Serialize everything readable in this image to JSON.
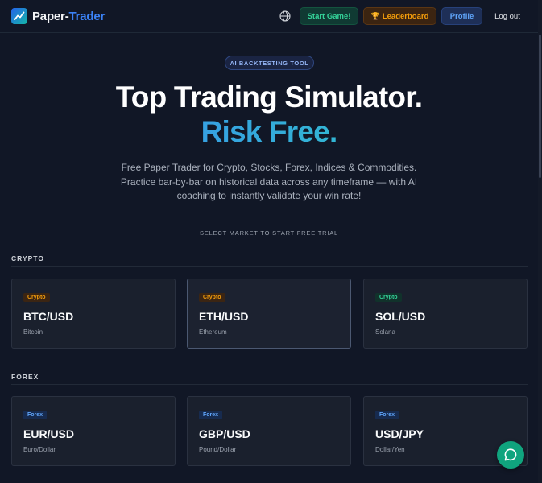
{
  "brand": {
    "part1": "Paper-",
    "part2": "Trader"
  },
  "nav": {
    "start": "Start Game!",
    "leaderboard_icon": "🏆",
    "leaderboard": "Leaderboard",
    "profile": "Profile",
    "logout": "Log out"
  },
  "hero": {
    "badge": "AI BACKTESTING TOOL",
    "title_line1": "Top Trading Simulator.",
    "title_line2": "Risk Free.",
    "subtitle": "Free Paper Trader for Crypto, Stocks, Forex, Indices & Commodities. Practice bar-by-bar on historical data across any timeframe — with AI coaching to instantly validate your win rate!",
    "select_label": "SELECT MARKET TO START FREE TRIAL"
  },
  "sections": {
    "crypto": {
      "title": "CRYPTO",
      "cards": [
        {
          "tag": "Crypto",
          "pair": "BTC/USD",
          "name": "Bitcoin"
        },
        {
          "tag": "Crypto",
          "pair": "ETH/USD",
          "name": "Ethereum"
        },
        {
          "tag": "Crypto",
          "pair": "SOL/USD",
          "name": "Solana"
        }
      ]
    },
    "forex": {
      "title": "FOREX",
      "cards": [
        {
          "tag": "Forex",
          "pair": "EUR/USD",
          "name": "Euro/Dollar"
        },
        {
          "tag": "Forex",
          "pair": "GBP/USD",
          "name": "Pound/Dollar"
        },
        {
          "tag": "Forex",
          "pair": "USD/JPY",
          "name": "Dollar/Yen"
        }
      ]
    }
  },
  "icons": {
    "logo": "trend-chart-icon",
    "language": "globe-icon",
    "chat": "chat-bubble-icon"
  },
  "colors": {
    "start": "#34d399",
    "leaderboard": "#f59e0b",
    "profile": "#60a5fa",
    "gradient_from": "#3b82f6",
    "gradient_to": "#2dd4bf"
  }
}
